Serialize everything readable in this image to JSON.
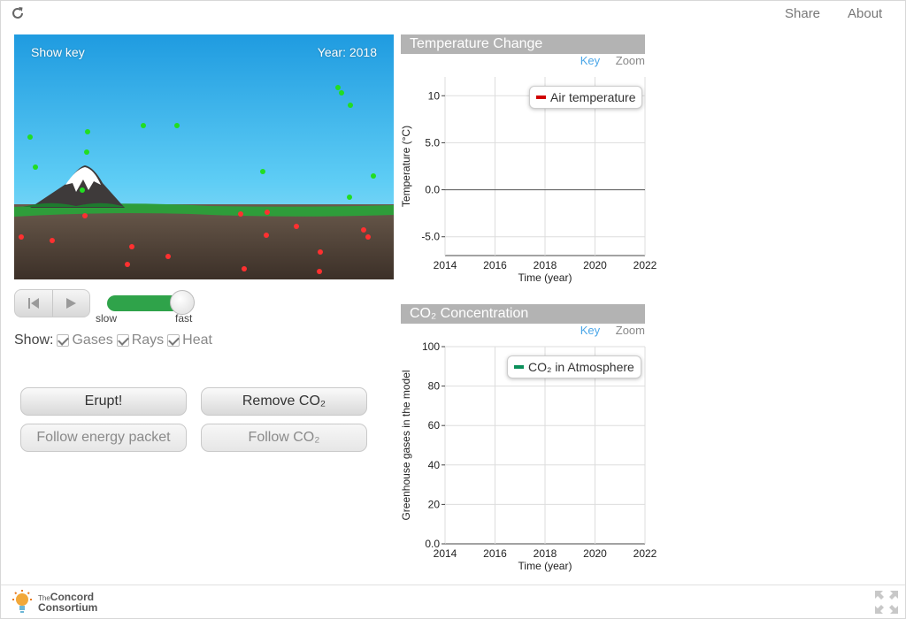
{
  "header": {
    "share": "Share",
    "about": "About"
  },
  "sim": {
    "show_key": "Show key",
    "year_label": "Year: 2018"
  },
  "controls": {
    "slow": "slow",
    "fast": "fast",
    "speed_fraction": 0.9
  },
  "show": {
    "label": "Show:",
    "options": [
      {
        "label": "Gases",
        "checked": true
      },
      {
        "label": "Rays",
        "checked": true
      },
      {
        "label": "Heat",
        "checked": true
      }
    ]
  },
  "buttons": {
    "erupt": "Erupt!",
    "remove_co2": "Remove CO₂",
    "follow_energy": "Follow energy packet",
    "follow_co2": "Follow CO₂"
  },
  "footer": {
    "logo_small": "The",
    "logo_line1": "Concord",
    "logo_line2": "Consortium"
  },
  "graphs": {
    "temperature": {
      "title": "Temperature Change",
      "key": "Key",
      "zoom": "Zoom",
      "legend": "Air temperature",
      "legend_color": "#d00000",
      "ylabel": "Temperature (°C)",
      "xlabel": "Time (year)"
    },
    "co2": {
      "title": "CO₂ Concentration",
      "key": "Key",
      "zoom": "Zoom",
      "legend": "CO₂ in Atmosphere",
      "legend_color": "#0a8f5a",
      "ylabel": "Greenhouse gases in the model",
      "xlabel": "Time (year)"
    }
  },
  "chart_data": [
    {
      "type": "line",
      "title": "Temperature Change",
      "xlabel": "Time (year)",
      "ylabel": "Temperature (°C)",
      "x_ticks": [
        "2014",
        "2016",
        "2018",
        "2020",
        "2022"
      ],
      "y_ticks": [
        "10",
        "5.0",
        "0.0",
        "-5.0"
      ],
      "xlim": [
        2014,
        2022
      ],
      "ylim": [
        -7,
        12
      ],
      "series": [
        {
          "name": "Air temperature",
          "x": [],
          "y": []
        }
      ],
      "grid": true,
      "legend": "top-right"
    },
    {
      "type": "line",
      "title": "CO₂ Concentration",
      "xlabel": "Time (year)",
      "ylabel": "Greenhouse gases in the model",
      "x_ticks": [
        "2014",
        "2016",
        "2018",
        "2020",
        "2022"
      ],
      "y_ticks": [
        "100",
        "80",
        "60",
        "40",
        "20",
        "0.0"
      ],
      "xlim": [
        2014,
        2022
      ],
      "ylim": [
        0,
        100
      ],
      "series": [
        {
          "name": "CO₂ in Atmosphere",
          "x": [],
          "y": []
        }
      ],
      "grid": true,
      "legend": "top-right"
    }
  ]
}
